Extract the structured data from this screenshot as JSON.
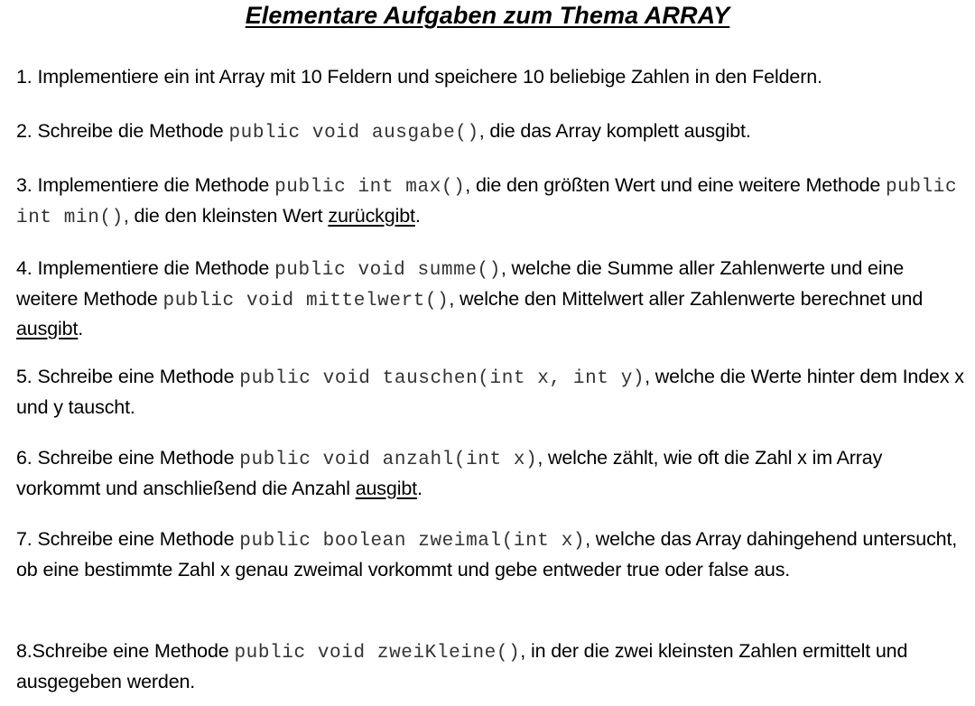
{
  "title": "Elementare Aufgaben zum Thema ARRAY",
  "tasks": [
    {
      "segments": [
        {
          "text": "1. Implementiere ein int Array mit 10 Feldern und speichere 10 beliebige Zahlen in den Feldern."
        }
      ]
    },
    {
      "segments": [
        {
          "text": "2. Schreibe die Methode "
        },
        {
          "text": "public void ausgabe()",
          "code": true
        },
        {
          "text": ", die das Array komplett ausgibt."
        }
      ]
    },
    {
      "segments": [
        {
          "text": "3. Implementiere die Methode "
        },
        {
          "text": "public int max()",
          "code": true
        },
        {
          "text": ", die den größten Wert und eine weitere Methode "
        },
        {
          "text": "public int min()",
          "code": true
        },
        {
          "text": ", die den kleinsten Wert "
        },
        {
          "text": "zurückgibt",
          "underline": true
        },
        {
          "text": "."
        }
      ]
    },
    {
      "segments": [
        {
          "text": "4. Implementiere die Methode "
        },
        {
          "text": "public void summe()",
          "code": true
        },
        {
          "text": ", welche die Summe aller Zahlenwerte und eine weitere Methode "
        },
        {
          "text": "public void mittelwert()",
          "code": true
        },
        {
          "text": ", welche den Mittelwert aller Zahlenwerte berechnet und "
        },
        {
          "text": "ausgibt",
          "underline": true
        },
        {
          "text": "."
        }
      ]
    },
    {
      "segments": [
        {
          "text": "5. Schreibe eine Methode "
        },
        {
          "text": "public void tauschen(int x, int y)",
          "code": true
        },
        {
          "text": ", welche die Werte hinter dem Index x und y tauscht."
        }
      ]
    },
    {
      "segments": [
        {
          "text": "6. Schreibe eine Methode "
        },
        {
          "text": "public void anzahl(int x)",
          "code": true
        },
        {
          "text": ", welche zählt, wie oft die Zahl x im Array vorkommt und anschließend die Anzahl "
        },
        {
          "text": "ausgibt",
          "underline": true
        },
        {
          "text": "."
        }
      ]
    },
    {
      "segments": [
        {
          "text": "7. Schreibe eine Methode "
        },
        {
          "text": "public boolean zweimal(int x)",
          "code": true
        },
        {
          "text": ", welche das Array dahingehend untersucht, ob eine bestimmte Zahl x genau zweimal vorkommt und gebe entweder true oder false aus."
        }
      ]
    },
    {
      "segments": [
        {
          "text": "8.Schreibe eine Methode "
        },
        {
          "text": "public void zweiKleine()",
          "code": true
        },
        {
          "text": ", in der die zwei kleinsten Zahlen ermittelt und ausgegeben werden."
        }
      ]
    }
  ]
}
